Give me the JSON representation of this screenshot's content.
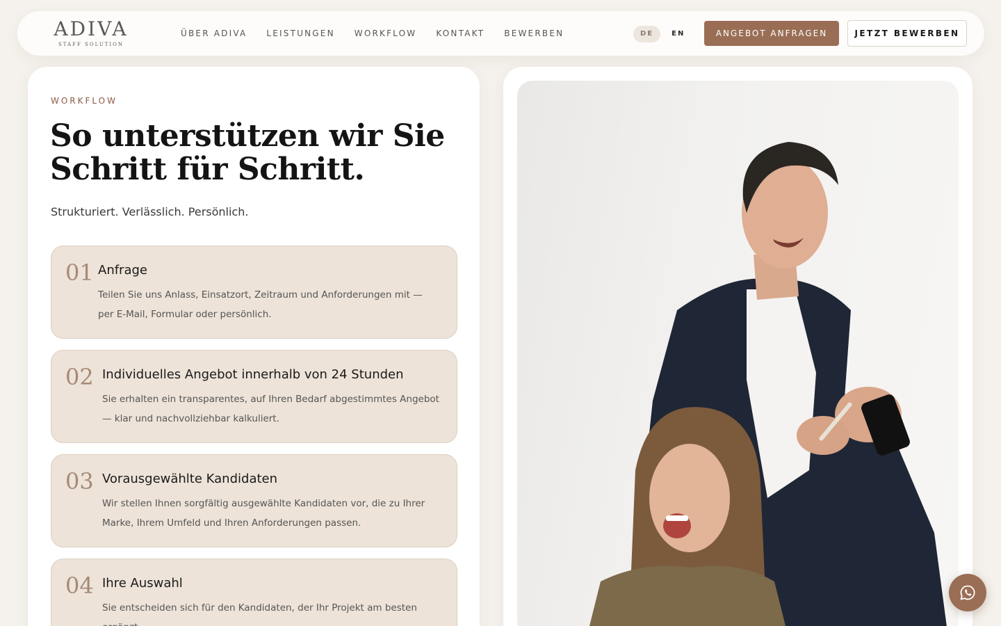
{
  "brand": {
    "name": "ADIVA",
    "sub": "STAFF SOLUTION"
  },
  "nav": {
    "links": [
      "ÜBER ADIVA",
      "LEISTUNGEN",
      "WORKFLOW",
      "KONTAKT",
      "BEWERBEN"
    ],
    "lang_active": "DE",
    "lang_other": "EN",
    "cta_offer": "ANGEBOT ANFRAGEN",
    "cta_apply": "JETZT BEWERBEN"
  },
  "section": {
    "eyebrow": "WORKFLOW",
    "headline_line1": "So unterstützen wir Sie",
    "headline_line2": "Schritt für Schritt.",
    "tagline": "Strukturiert. Verlässlich. Persönlich."
  },
  "steps": [
    {
      "num": "01",
      "title": "Anfrage",
      "desc": "Teilen Sie uns Anlass, Einsatzort, Zeitraum und Anforderungen mit — per E-Mail, Formular oder persönlich."
    },
    {
      "num": "02",
      "title": "Individuelles Angebot innerhalb von 24 Stunden",
      "desc": "Sie erhalten ein transparentes, auf Ihren Bedarf abgestimmtes Angebot — klar und nachvollziehbar kalkuliert."
    },
    {
      "num": "03",
      "title": "Vorausgewählte Kandidaten",
      "desc": "Wir stellen Ihnen sorgfältig ausgewählte Kandidaten vor, die zu Ihrer Marke, Ihrem Umfeld und Ihren Anforderungen passen."
    },
    {
      "num": "04",
      "title": "Ihre Auswahl",
      "desc": "Sie entscheiden sich für den Kandidaten, der Ihr Projekt am besten ergänzt."
    }
  ],
  "colors": {
    "accent": "#9a6e55",
    "card": "#ede3d8",
    "page_bg": "#f5f1ec"
  },
  "icons": {
    "floating": "whatsapp-icon"
  }
}
